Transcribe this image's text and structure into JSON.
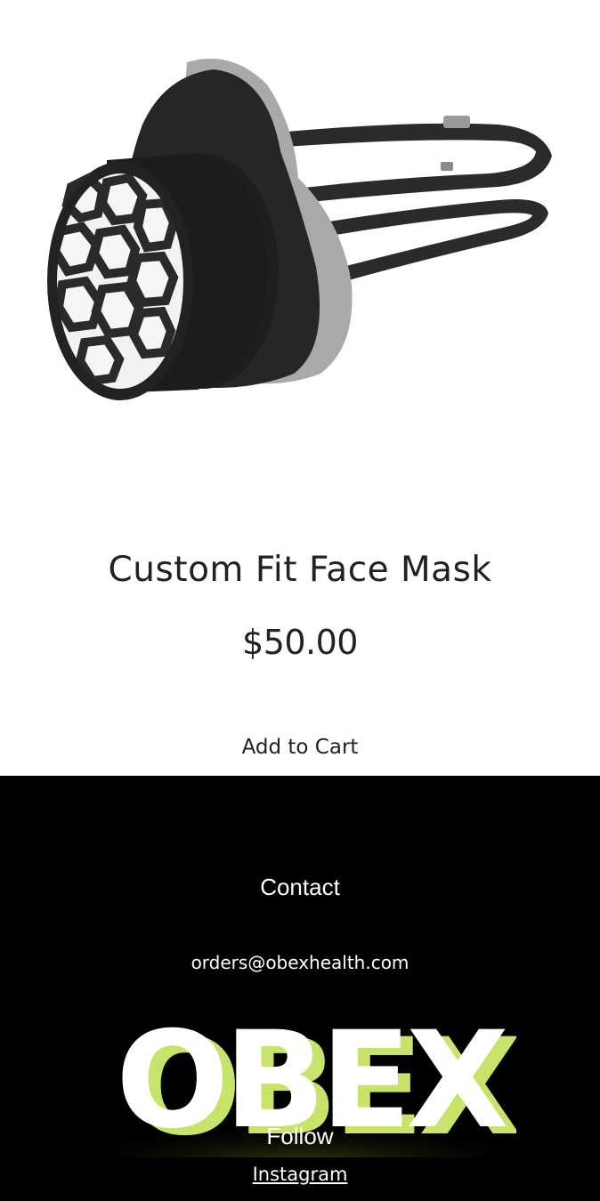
{
  "product": {
    "image_alt": "Custom Fit Face Mask",
    "title": "Custom Fit Face Mask",
    "price": "$50.00",
    "add_to_cart_label": "Add to Cart"
  },
  "footer": {
    "contact_heading": "Contact",
    "email": "orders@obexhealth.com",
    "logo_text": "OBEX",
    "follow_heading": "Follow",
    "instagram_label": "Instagram"
  },
  "colors": {
    "footer_background": "#000000",
    "logo_green": "#d6f07a",
    "logo_face": "#ffffff",
    "text_dark": "#222222"
  }
}
